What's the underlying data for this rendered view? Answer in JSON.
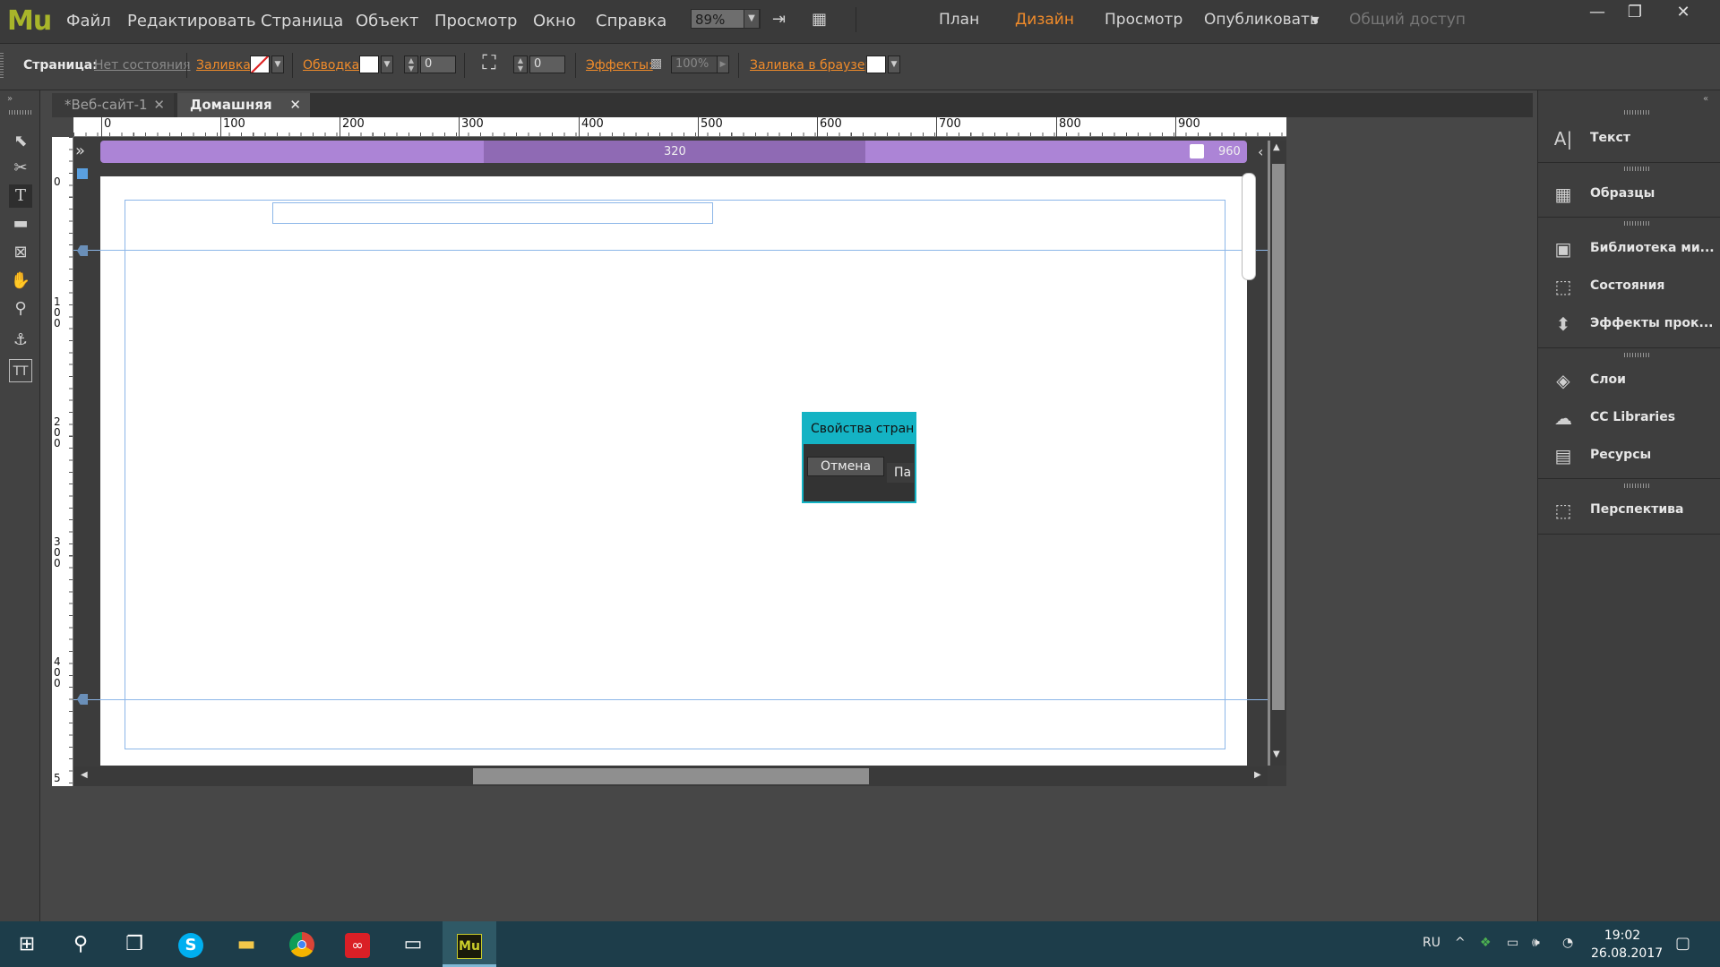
{
  "app": {
    "logo": "Mu"
  },
  "menu": [
    "Файл",
    "Редактировать",
    "Страница",
    "Объект",
    "Просмотр",
    "Окно",
    "Справка"
  ],
  "toolbar": {
    "zoom": "89%"
  },
  "modes": {
    "plan": "План",
    "design": "Дизайн",
    "preview": "Просмотр",
    "publish": "Опубликовать",
    "share": "Общий доступ"
  },
  "controlbar": {
    "page_label": "Страница:",
    "page_state": "Нет состояния",
    "fill_label": "Заливка:",
    "stroke_label": "Обводка:",
    "stroke_value": "0",
    "corner_value": "0",
    "effects_label": "Эффекты:",
    "opacity_value": "100%",
    "browser_fill_label": "Заливка в браузере"
  },
  "tabs": [
    {
      "label": "*Веб-сайт-1",
      "active": false
    },
    {
      "label": "Домашняя",
      "active": true
    }
  ],
  "ruler": {
    "h_labels": [
      "0",
      "100",
      "200",
      "300",
      "400",
      "500",
      "600",
      "700",
      "800",
      "900"
    ],
    "v_labels": [
      "0",
      "1\n0\n0",
      "2\n0\n0",
      "3\n0\n0",
      "4\n0\n0",
      "5"
    ]
  },
  "breakpoints": {
    "current": "320",
    "max": "960"
  },
  "dialog": {
    "title": "Свойства стран...",
    "cancel": "Отмена",
    "tab": "Па"
  },
  "panels": [
    {
      "label": "Текст",
      "icon": "text-panel-icon"
    },
    {
      "label": "Образцы",
      "icon": "swatches-icon"
    },
    {
      "label": "Библиотека ми...",
      "icon": "widgets-library-icon"
    },
    {
      "label": "Состояния",
      "icon": "states-icon"
    },
    {
      "label": "Эффекты прок...",
      "icon": "scroll-effects-icon"
    },
    {
      "label": "Слои",
      "icon": "layers-icon"
    },
    {
      "label": "CC Libraries",
      "icon": "cc-libraries-icon"
    },
    {
      "label": "Ресурсы",
      "icon": "assets-icon"
    },
    {
      "label": "Перспектива",
      "icon": "perspective-icon"
    }
  ],
  "taskbar": {
    "lang": "RU",
    "time": "19:02",
    "date": "26.08.2017"
  },
  "colors": {
    "accent": "#f08b2a",
    "dialog": "#14b3c4",
    "breakpoint": "#ac84d6"
  }
}
